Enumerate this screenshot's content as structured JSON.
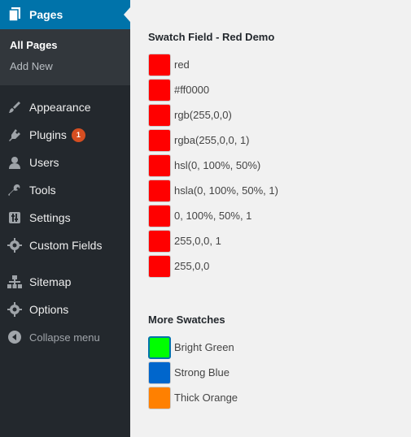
{
  "sidebar": {
    "current": {
      "label": "Pages",
      "icon": "pages-icon"
    },
    "submenu": [
      {
        "label": "All Pages",
        "current": true
      },
      {
        "label": "Add New",
        "current": false
      }
    ],
    "items": [
      {
        "label": "Appearance",
        "icon": "paintbrush-icon"
      },
      {
        "label": "Plugins",
        "icon": "plugins-icon",
        "badge": "1"
      },
      {
        "label": "Users",
        "icon": "users-icon"
      },
      {
        "label": "Tools",
        "icon": "wrench-icon"
      },
      {
        "label": "Settings",
        "icon": "settings-icon"
      },
      {
        "label": "Custom Fields",
        "icon": "gear-icon"
      },
      {
        "label": "Sitemap",
        "icon": "sitemap-icon"
      },
      {
        "label": "Options",
        "icon": "gear-icon"
      }
    ],
    "collapse_label": "Collapse menu"
  },
  "main": {
    "red_section": {
      "title": "Swatch Field - Red Demo",
      "swatches": [
        {
          "label": "red",
          "color": "#ff0000"
        },
        {
          "label": "#ff0000",
          "color": "#ff0000"
        },
        {
          "label": "rgb(255,0,0)",
          "color": "#ff0000"
        },
        {
          "label": "rgba(255,0,0, 1)",
          "color": "#ff0000"
        },
        {
          "label": "hsl(0, 100%, 50%)",
          "color": "#ff0000"
        },
        {
          "label": "hsla(0, 100%, 50%, 1)",
          "color": "#ff0000"
        },
        {
          "label": "0, 100%, 50%, 1",
          "color": "#ff0000"
        },
        {
          "label": "255,0,0, 1",
          "color": "#ff0000"
        },
        {
          "label": "255,0,0",
          "color": "#ff0000"
        }
      ]
    },
    "more_section": {
      "title": "More Swatches",
      "swatches": [
        {
          "label": "Bright Green",
          "color": "#00ff00"
        },
        {
          "label": "Strong Blue",
          "color": "#0066cc"
        },
        {
          "label": "Thick Orange",
          "color": "#ff8000"
        }
      ]
    }
  }
}
